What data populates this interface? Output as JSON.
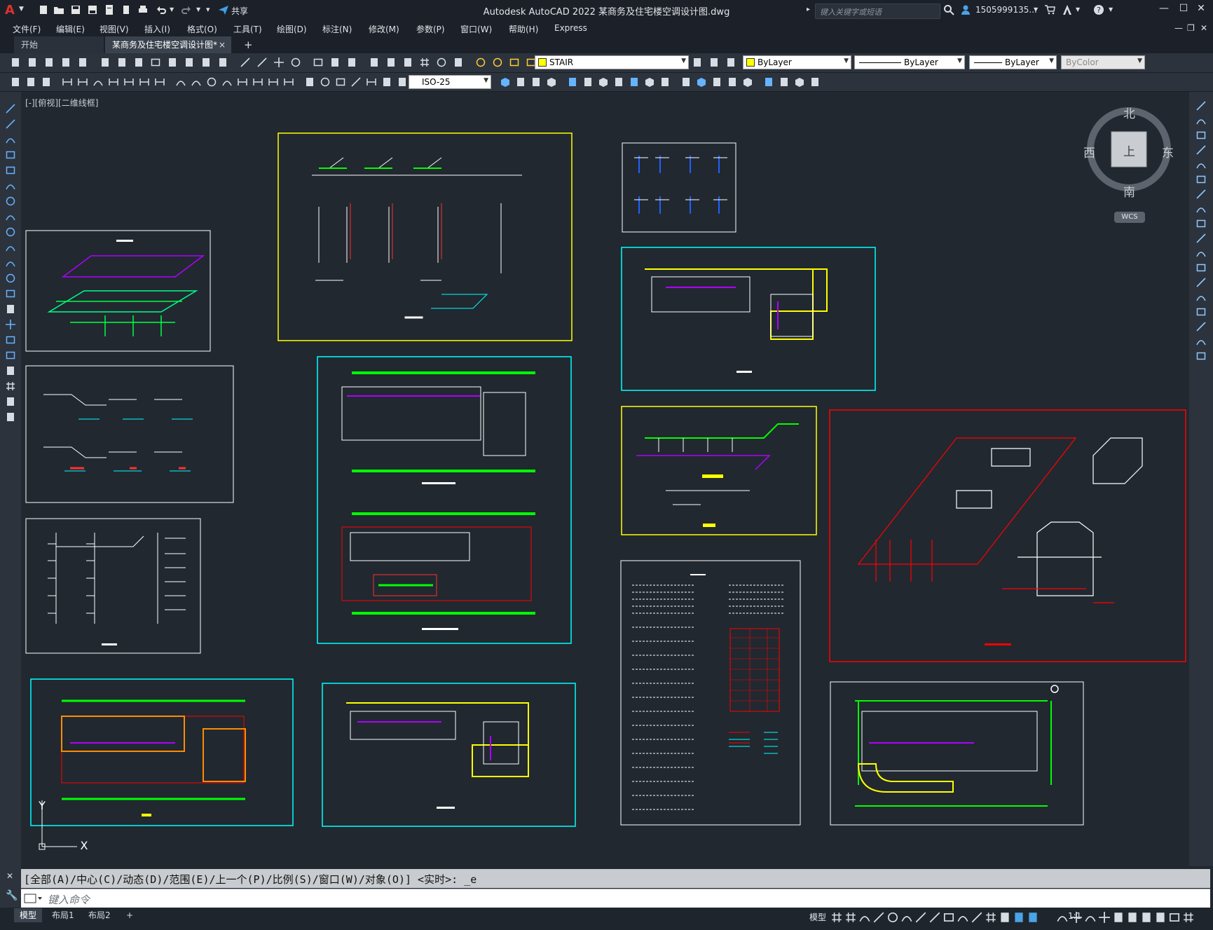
{
  "titlebar": {
    "app_title": "Autodesk AutoCAD 2022    某商务及住宅楼空调设计图.dwg",
    "search_placeholder": "键入关键字或短语",
    "user_name": "1505999135...",
    "share_label": "共享"
  },
  "menu": {
    "items": [
      "文件(F)",
      "编辑(E)",
      "视图(V)",
      "插入(I)",
      "格式(O)",
      "工具(T)",
      "绘图(D)",
      "标注(N)",
      "修改(M)",
      "参数(P)",
      "窗口(W)",
      "帮助(H)",
      "Express"
    ]
  },
  "tabs": {
    "start": "开始",
    "document": "某商务及住宅楼空调设计图*",
    "close": "×",
    "add": "+"
  },
  "properties": {
    "layer": "STAIR",
    "color": "ByLayer",
    "linetype": "ByLayer",
    "lineweight": "ByLayer",
    "plotstyle": "ByColor",
    "dimstyle": "ISO-25",
    "layer_color": "#ffff00"
  },
  "viewport": {
    "label": "[-][俯视][二维线框]"
  },
  "viewcube": {
    "north": "北",
    "south": "南",
    "east": "东",
    "west": "西",
    "top": "上",
    "wcs": "WCS"
  },
  "command": {
    "history": "[全部(A)/中心(C)/动态(D)/范围(E)/上一个(P)/比例(S)/窗口(W)/对象(O)] <实时>: _e",
    "placeholder": "键入命令"
  },
  "statusbar": {
    "layouts": [
      "模型",
      "布局1",
      "布局2"
    ],
    "model_label": "模型",
    "scale": "1:1"
  }
}
